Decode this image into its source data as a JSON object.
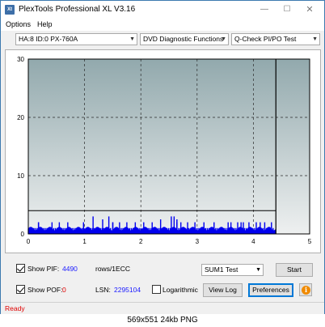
{
  "window": {
    "title": "PlexTools Professional XL V3.16",
    "app_icon_label": "Xt",
    "minimize_glyph": "—",
    "maximize_glyph": "☐",
    "close_glyph": "✕"
  },
  "menu": {
    "options": "Options",
    "help": "Help"
  },
  "toolbar": {
    "drive": "HA:8 ID:0  PX-760A",
    "function": "DVD Diagnostic Functions",
    "test": "Q-Check PI/PO Test",
    "dropdown_glyph": "▼"
  },
  "chart_data": {
    "type": "bar",
    "x_ticks": [
      "0",
      "1",
      "2",
      "3",
      "4",
      "5"
    ],
    "y_ticks": [
      "0",
      "10",
      "20",
      "30"
    ],
    "xlim": [
      0,
      5
    ],
    "ylim": [
      0,
      30
    ],
    "scan_end_x": 4.4,
    "threshold_y": 4,
    "grid": true,
    "colors": {
      "plot_bg_top": "#92a9ad",
      "plot_bg_bottom": "#eef0f0",
      "bars": "#0000ee",
      "grid": "#2a2a2a",
      "border": "#000000"
    },
    "bars_pif": [
      [
        0.02,
        1
      ],
      [
        0.05,
        1
      ],
      [
        0.08,
        1
      ],
      [
        0.1,
        1
      ],
      [
        0.13,
        1
      ],
      [
        0.16,
        1
      ],
      [
        0.18,
        2
      ],
      [
        0.21,
        1
      ],
      [
        0.24,
        1
      ],
      [
        0.27,
        1
      ],
      [
        0.3,
        1
      ],
      [
        0.33,
        1
      ],
      [
        0.36,
        1
      ],
      [
        0.39,
        1
      ],
      [
        0.42,
        1
      ],
      [
        0.45,
        1
      ],
      [
        0.48,
        1
      ],
      [
        0.51,
        1
      ],
      [
        0.54,
        1
      ],
      [
        0.57,
        1
      ],
      [
        0.6,
        1
      ],
      [
        0.63,
        1
      ],
      [
        0.66,
        1
      ],
      [
        0.69,
        1
      ],
      [
        0.72,
        1
      ],
      [
        0.75,
        1
      ],
      [
        0.78,
        1
      ],
      [
        0.81,
        1
      ],
      [
        0.84,
        1
      ],
      [
        0.87,
        1
      ],
      [
        0.9,
        1
      ],
      [
        0.93,
        1
      ],
      [
        0.96,
        1
      ],
      [
        0.99,
        1
      ],
      [
        1.02,
        1
      ],
      [
        1.05,
        1
      ],
      [
        1.08,
        1
      ],
      [
        1.11,
        1
      ],
      [
        1.14,
        1
      ],
      [
        1.17,
        1
      ],
      [
        1.2,
        1
      ],
      [
        1.22,
        1
      ],
      [
        1.25,
        1
      ],
      [
        1.28,
        1
      ],
      [
        1.31,
        1
      ],
      [
        1.34,
        1
      ],
      [
        1.37,
        1
      ],
      [
        1.4,
        1
      ],
      [
        1.43,
        1
      ],
      [
        1.46,
        1
      ],
      [
        1.5,
        2
      ],
      [
        1.53,
        1
      ],
      [
        1.56,
        1
      ],
      [
        1.59,
        1
      ],
      [
        1.62,
        1
      ],
      [
        1.65,
        1
      ],
      [
        1.68,
        1
      ],
      [
        1.71,
        1
      ],
      [
        1.74,
        1
      ],
      [
        1.77,
        1
      ],
      [
        1.8,
        1
      ],
      [
        1.83,
        1
      ],
      [
        1.86,
        1
      ],
      [
        1.89,
        1
      ],
      [
        1.92,
        1
      ],
      [
        1.95,
        1
      ],
      [
        1.98,
        1
      ],
      [
        2.01,
        1
      ],
      [
        2.04,
        1
      ],
      [
        2.07,
        1
      ],
      [
        2.1,
        1
      ],
      [
        2.13,
        1
      ],
      [
        2.16,
        1
      ],
      [
        2.19,
        1
      ],
      [
        2.22,
        1
      ],
      [
        2.25,
        1
      ],
      [
        2.28,
        1
      ],
      [
        2.31,
        1
      ],
      [
        2.34,
        1
      ],
      [
        2.37,
        1
      ],
      [
        2.4,
        1
      ],
      [
        2.43,
        1
      ],
      [
        2.46,
        1
      ],
      [
        2.49,
        1
      ],
      [
        2.52,
        1
      ],
      [
        2.55,
        1
      ],
      [
        2.58,
        1
      ],
      [
        2.61,
        1
      ],
      [
        2.64,
        2
      ],
      [
        2.67,
        1
      ],
      [
        2.7,
        1
      ],
      [
        2.73,
        1
      ],
      [
        2.76,
        1
      ],
      [
        2.79,
        1
      ],
      [
        2.82,
        1
      ],
      [
        2.85,
        1
      ],
      [
        2.88,
        1
      ],
      [
        2.91,
        1
      ],
      [
        2.94,
        1
      ],
      [
        2.97,
        1
      ],
      [
        3.0,
        1
      ],
      [
        3.03,
        1
      ],
      [
        3.06,
        1
      ],
      [
        3.09,
        1
      ],
      [
        3.12,
        1
      ],
      [
        3.15,
        1
      ],
      [
        3.18,
        1
      ],
      [
        3.21,
        1
      ],
      [
        3.24,
        1
      ],
      [
        3.27,
        1
      ],
      [
        3.3,
        1
      ],
      [
        3.33,
        1
      ],
      [
        3.36,
        1
      ],
      [
        3.39,
        1
      ],
      [
        3.42,
        1
      ],
      [
        3.45,
        1
      ],
      [
        3.48,
        1
      ],
      [
        3.51,
        1
      ],
      [
        3.54,
        1
      ],
      [
        3.57,
        1
      ],
      [
        3.6,
        1
      ],
      [
        3.63,
        1
      ],
      [
        3.66,
        1
      ],
      [
        3.69,
        1
      ],
      [
        3.72,
        1
      ],
      [
        3.75,
        1
      ],
      [
        3.78,
        1
      ],
      [
        3.81,
        1
      ],
      [
        3.84,
        1
      ],
      [
        3.87,
        1
      ],
      [
        3.9,
        1
      ],
      [
        3.93,
        1
      ],
      [
        3.96,
        1
      ],
      [
        3.99,
        1
      ],
      [
        4.02,
        1
      ],
      [
        4.05,
        1
      ],
      [
        4.08,
        1
      ],
      [
        4.11,
        1
      ],
      [
        4.14,
        1
      ],
      [
        4.17,
        1
      ],
      [
        4.2,
        1
      ],
      [
        4.23,
        1
      ],
      [
        4.26,
        1
      ],
      [
        4.29,
        1
      ],
      [
        4.32,
        1
      ],
      [
        4.35,
        1
      ]
    ],
    "bars_spikes": [
      [
        0.18,
        2
      ],
      [
        0.42,
        2
      ],
      [
        0.55,
        2
      ],
      [
        0.7,
        2
      ],
      [
        0.98,
        2
      ],
      [
        1.15,
        3
      ],
      [
        1.32,
        2.5
      ],
      [
        1.43,
        3
      ],
      [
        1.5,
        2
      ],
      [
        1.62,
        2
      ],
      [
        1.75,
        2
      ],
      [
        1.9,
        2
      ],
      [
        2.05,
        2
      ],
      [
        2.2,
        2
      ],
      [
        2.35,
        2.5
      ],
      [
        2.54,
        3
      ],
      [
        2.59,
        3
      ],
      [
        2.64,
        2.5
      ],
      [
        2.71,
        2
      ],
      [
        2.83,
        2
      ],
      [
        2.96,
        2
      ],
      [
        3.12,
        2
      ],
      [
        3.3,
        2
      ],
      [
        3.55,
        2
      ],
      [
        3.6,
        2
      ],
      [
        3.72,
        2
      ],
      [
        3.78,
        2
      ],
      [
        3.82,
        2
      ],
      [
        3.92,
        2
      ],
      [
        4.05,
        2
      ],
      [
        4.12,
        2
      ],
      [
        4.2,
        2
      ],
      [
        4.32,
        2
      ]
    ]
  },
  "controls": {
    "show_pif_label": "Show PIF:",
    "pif_value": "4490",
    "pif_unit": "rows/1ECC",
    "show_pof_label": "Show POF:",
    "pof_value": "0",
    "lsn_label": "LSN:",
    "lsn_value": "2295104",
    "logarithmic_label": "Logarithmic",
    "sum_select": "SUM1 Test",
    "start_button": "Start",
    "view_log_button": "View Log",
    "preferences_button": "Preferences",
    "info_glyph": "i"
  },
  "status": {
    "text": "Ready"
  },
  "caption": {
    "text": "569x551 24kb PNG"
  }
}
